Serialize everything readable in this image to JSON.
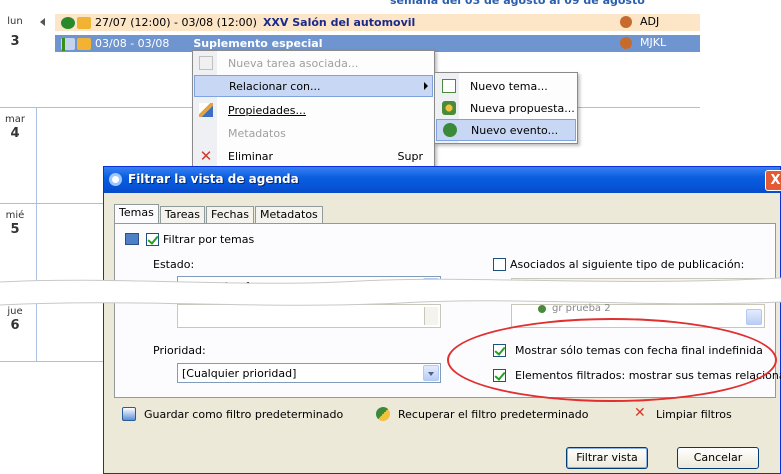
{
  "agenda": {
    "top_header": "semana del 03 de agosto al 09 de agosto",
    "days": [
      {
        "name": "lun",
        "num": "3"
      },
      {
        "name": "mar",
        "num": "4"
      },
      {
        "name": "mié",
        "num": "5"
      },
      {
        "name": "jue",
        "num": "6"
      }
    ],
    "events": [
      {
        "dates": "27/07 (12:00) - 03/08 (12:00)",
        "title": "XXV Salón del automovil",
        "user": "ADJ"
      },
      {
        "dates": "03/08 - 03/08",
        "title": "Suplemento especial",
        "user": "MJKL"
      }
    ]
  },
  "context_menu": {
    "items": [
      {
        "label": "Nueva tarea asociada...",
        "disabled": true
      },
      {
        "label": "Relacionar con...",
        "highlighted": true
      },
      {
        "label": "Propiedades..."
      },
      {
        "label": "Metadatos",
        "disabled": true
      },
      {
        "label": "Eliminar",
        "shortcut": "Supr"
      }
    ],
    "submenu": [
      {
        "label": "Nuevo tema..."
      },
      {
        "label": "Nueva propuesta..."
      },
      {
        "label": "Nuevo evento...",
        "highlighted": true
      }
    ]
  },
  "dialog": {
    "title": "Filtrar la vista de agenda",
    "close_glyph": "X",
    "tabs": [
      "Temas",
      "Tareas",
      "Fechas",
      "Metadatos"
    ],
    "filter_by_topics_label": "Filtrar por temas",
    "status_label": "Estado:",
    "status_value": "[Cualquiera]",
    "associated_label": "Asociados al siguiente tipo de publicación:",
    "list_fragment": "gr prueba 2",
    "priority_label": "Prioridad:",
    "priority_value": "[Cualquier prioridad]",
    "show_only_undefined_end_label": "Mostrar sólo temas con fecha final indefinida",
    "filtered_elements_label": "Elementos filtrados: mostrar sus temas relacionados",
    "save_default_label": "Guardar como filtro predeterminado",
    "restore_default_label": "Recuperar el filtro predeterminado",
    "clear_filters_label": "Limpiar filtros",
    "filter_button": "Filtrar vista",
    "cancel_button": "Cancelar"
  },
  "colors": {
    "event_orange": "#fde6c8",
    "event_selected": "#6e95d0",
    "xp_titlebar": "#0a5fe0",
    "highlight_ellipse": "#e03030"
  }
}
